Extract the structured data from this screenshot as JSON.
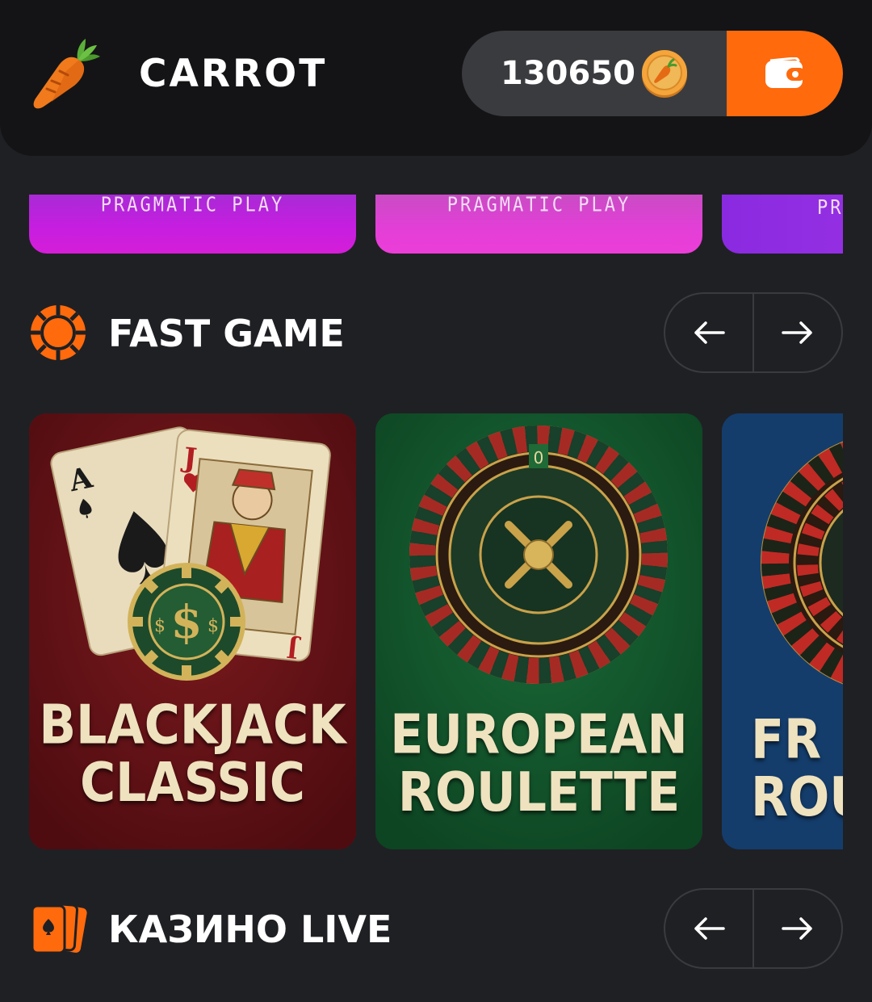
{
  "header": {
    "brand": "CARROT",
    "balance": "130650",
    "icons": {
      "logo": "carrot-icon",
      "coin": "carrot-coin-icon",
      "wallet": "wallet-icon"
    }
  },
  "colors": {
    "accent": "#ff6a0d",
    "background": "#1f2024",
    "header_bg": "#141416",
    "pill_bg": "#3a3b3f"
  },
  "providers": [
    {
      "label": "PRAGMATIC PLAY"
    },
    {
      "label": "PRAGMATIC PLAY"
    },
    {
      "label": "PRA"
    }
  ],
  "sections": {
    "fast_game": {
      "title": "FAST GAME",
      "icon": "chip-icon"
    },
    "casino_live": {
      "title": "КАЗИНО LIVE",
      "icon": "cards-icon"
    }
  },
  "games": [
    {
      "title": "BLACKJACK\nCLASSIC"
    },
    {
      "title": "EUROPEAN\nROULETTE"
    },
    {
      "title": "FR\nROU"
    }
  ]
}
